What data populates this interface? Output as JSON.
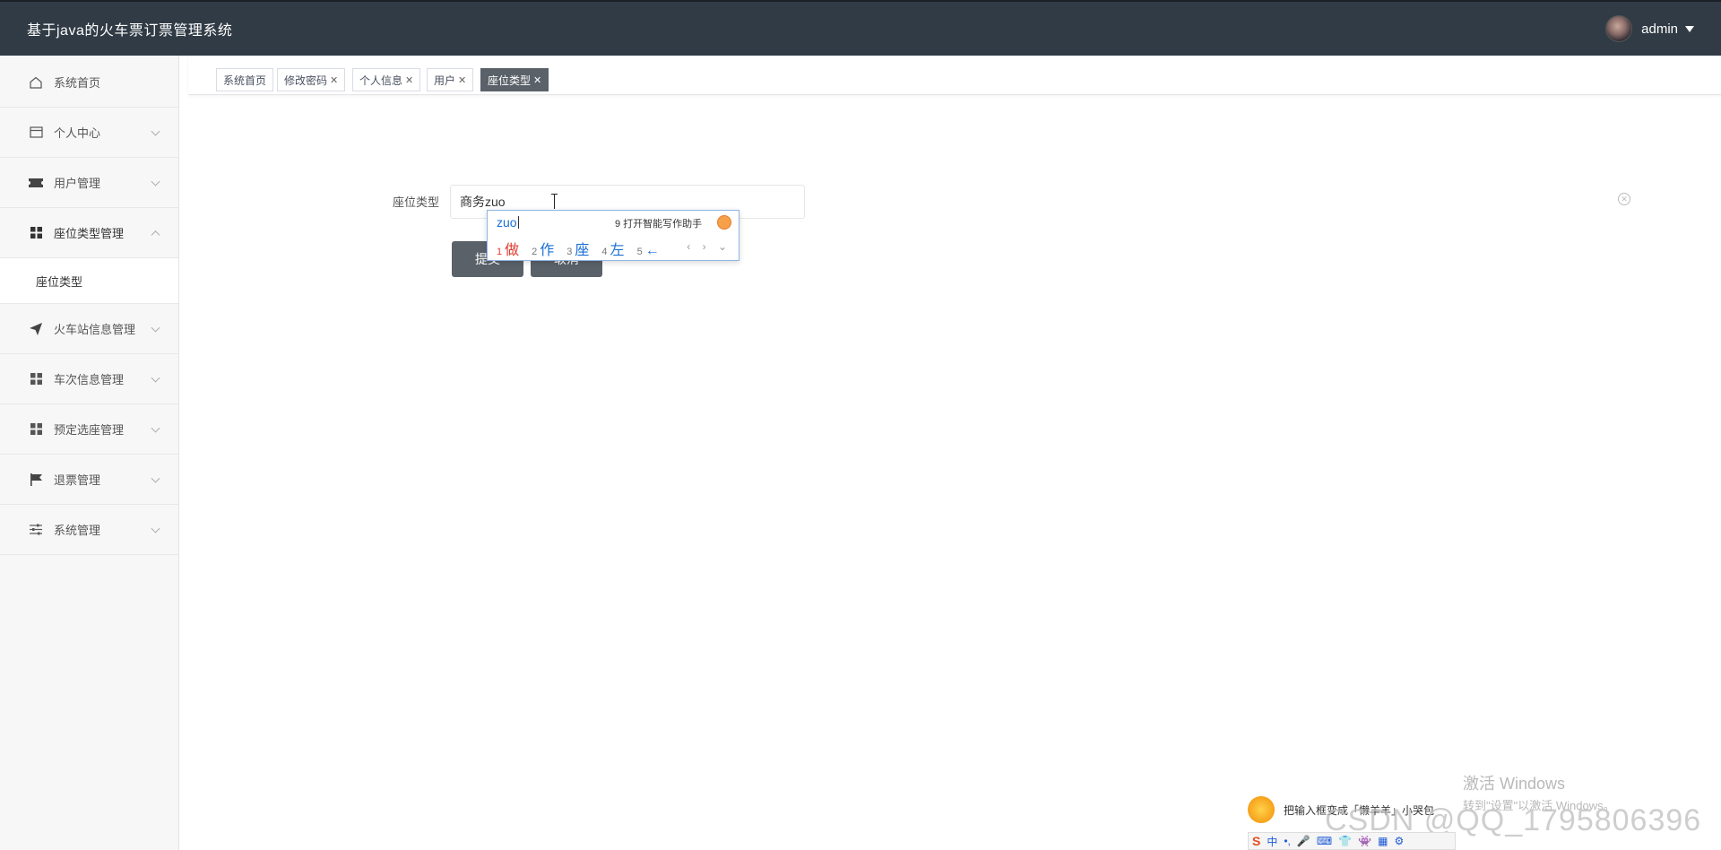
{
  "header": {
    "title": "基于java的火车票订票管理系统",
    "username": "admin"
  },
  "sidebar": {
    "items": [
      {
        "label": "系统首页",
        "icon": "home-icon"
      },
      {
        "label": "个人中心",
        "icon": "id-card-icon"
      },
      {
        "label": "用户管理",
        "icon": "ticket-icon"
      },
      {
        "label": "座位类型管理",
        "icon": "grid-icon",
        "open": true
      },
      {
        "label": "火车站信息管理",
        "icon": "paper-plane-icon"
      },
      {
        "label": "车次信息管理",
        "icon": "grid-icon"
      },
      {
        "label": "预定选座管理",
        "icon": "grid-icon"
      },
      {
        "label": "退票管理",
        "icon": "flag-icon"
      },
      {
        "label": "系统管理",
        "icon": "sliders-icon"
      }
    ],
    "submenu": {
      "label": "座位类型"
    }
  },
  "tabs": [
    {
      "label": "系统首页",
      "closable": false
    },
    {
      "label": "修改密码",
      "closable": true
    },
    {
      "label": "个人信息",
      "closable": true
    },
    {
      "label": "用户",
      "closable": true
    },
    {
      "label": "座位类型",
      "closable": true,
      "active": true
    }
  ],
  "form": {
    "label": "座位类型",
    "value": "商务zuo",
    "submit": "提交",
    "cancel": "取消"
  },
  "ime": {
    "composition": "zuo",
    "assist": "9 打开智能写作助手",
    "candidates": [
      {
        "num": "1",
        "text": "做"
      },
      {
        "num": "2",
        "text": "作"
      },
      {
        "num": "3",
        "text": "座"
      },
      {
        "num": "4",
        "text": "左"
      },
      {
        "num": "5",
        "text": "←"
      }
    ],
    "nav": "‹ › ⌄",
    "tip": "把输入框变成「懒羊羊」小哭包",
    "toolbar": [
      "S",
      "中",
      "•,",
      "🎤",
      "⌨",
      "👕",
      "👾",
      "▦",
      "⚙"
    ]
  },
  "watermark": {
    "activate_title": "激活 Windows",
    "activate_sub": "转到\"设置\"以激活 Windows。",
    "csdn": "CSDN @QQ_1795806396"
  },
  "colors": {
    "header_bg": "#303b45",
    "active_tab": "#5a6169",
    "button": "#5a6169"
  }
}
